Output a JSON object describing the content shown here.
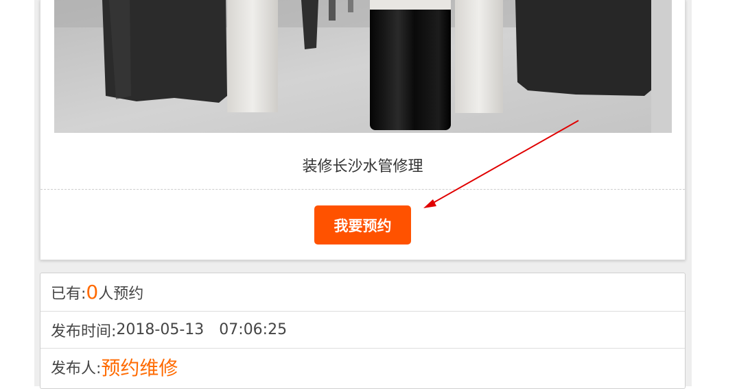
{
  "listing": {
    "title": "装修长沙水管修理",
    "book_button_label": "我要预约"
  },
  "info": {
    "booked_prefix": "已有:",
    "booked_count": "0",
    "booked_suffix": "人预约",
    "publish_time_label": "发布时间:",
    "publish_date": "2018-05-13",
    "publish_time": "07:06:25",
    "publisher_label": "发布人:",
    "publisher_name": "预约维修"
  },
  "colors": {
    "accent": "#ff6a00",
    "button": "#ff5200",
    "annotation_arrow": "#e00000"
  }
}
